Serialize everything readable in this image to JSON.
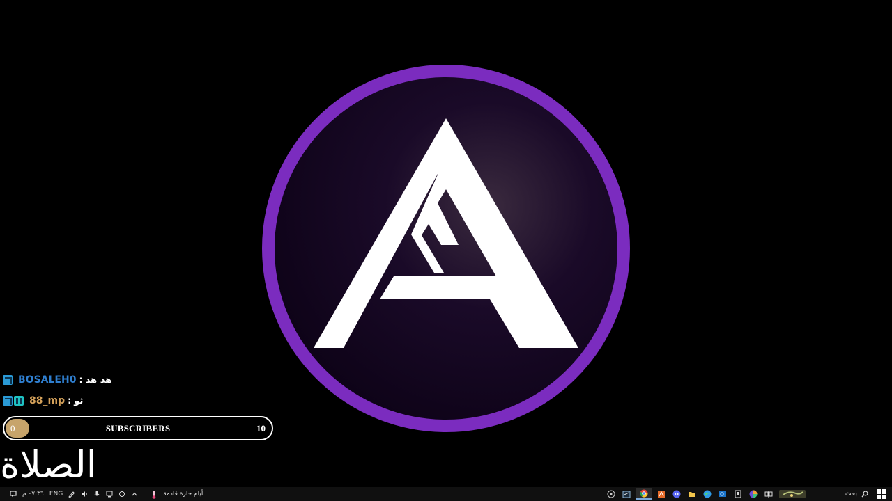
{
  "chat": [
    {
      "username": "BOSALEH0",
      "separator": ":",
      "message": "هد هد",
      "name_color": "#2f7fd0",
      "badges": [
        "blue"
      ]
    },
    {
      "username": "88_mp",
      "separator": ":",
      "message": "ثو",
      "name_color": "#d4a15a",
      "badges": [
        "blue",
        "cyan"
      ]
    }
  ],
  "subscribers": {
    "label": "SUBSCRIBERS",
    "start": "0",
    "goal": "10",
    "progress": 0.0
  },
  "headline": "الصلاة",
  "taskbar": {
    "time": "٠٧:٣٦ م",
    "language": "ENG",
    "weather_text": "أيام حارة قادمة",
    "search_label": "بحث"
  },
  "colors": {
    "ring": "#7b2cbf",
    "logo_bg": "#140623",
    "accent_gold": "#c7a46b"
  }
}
